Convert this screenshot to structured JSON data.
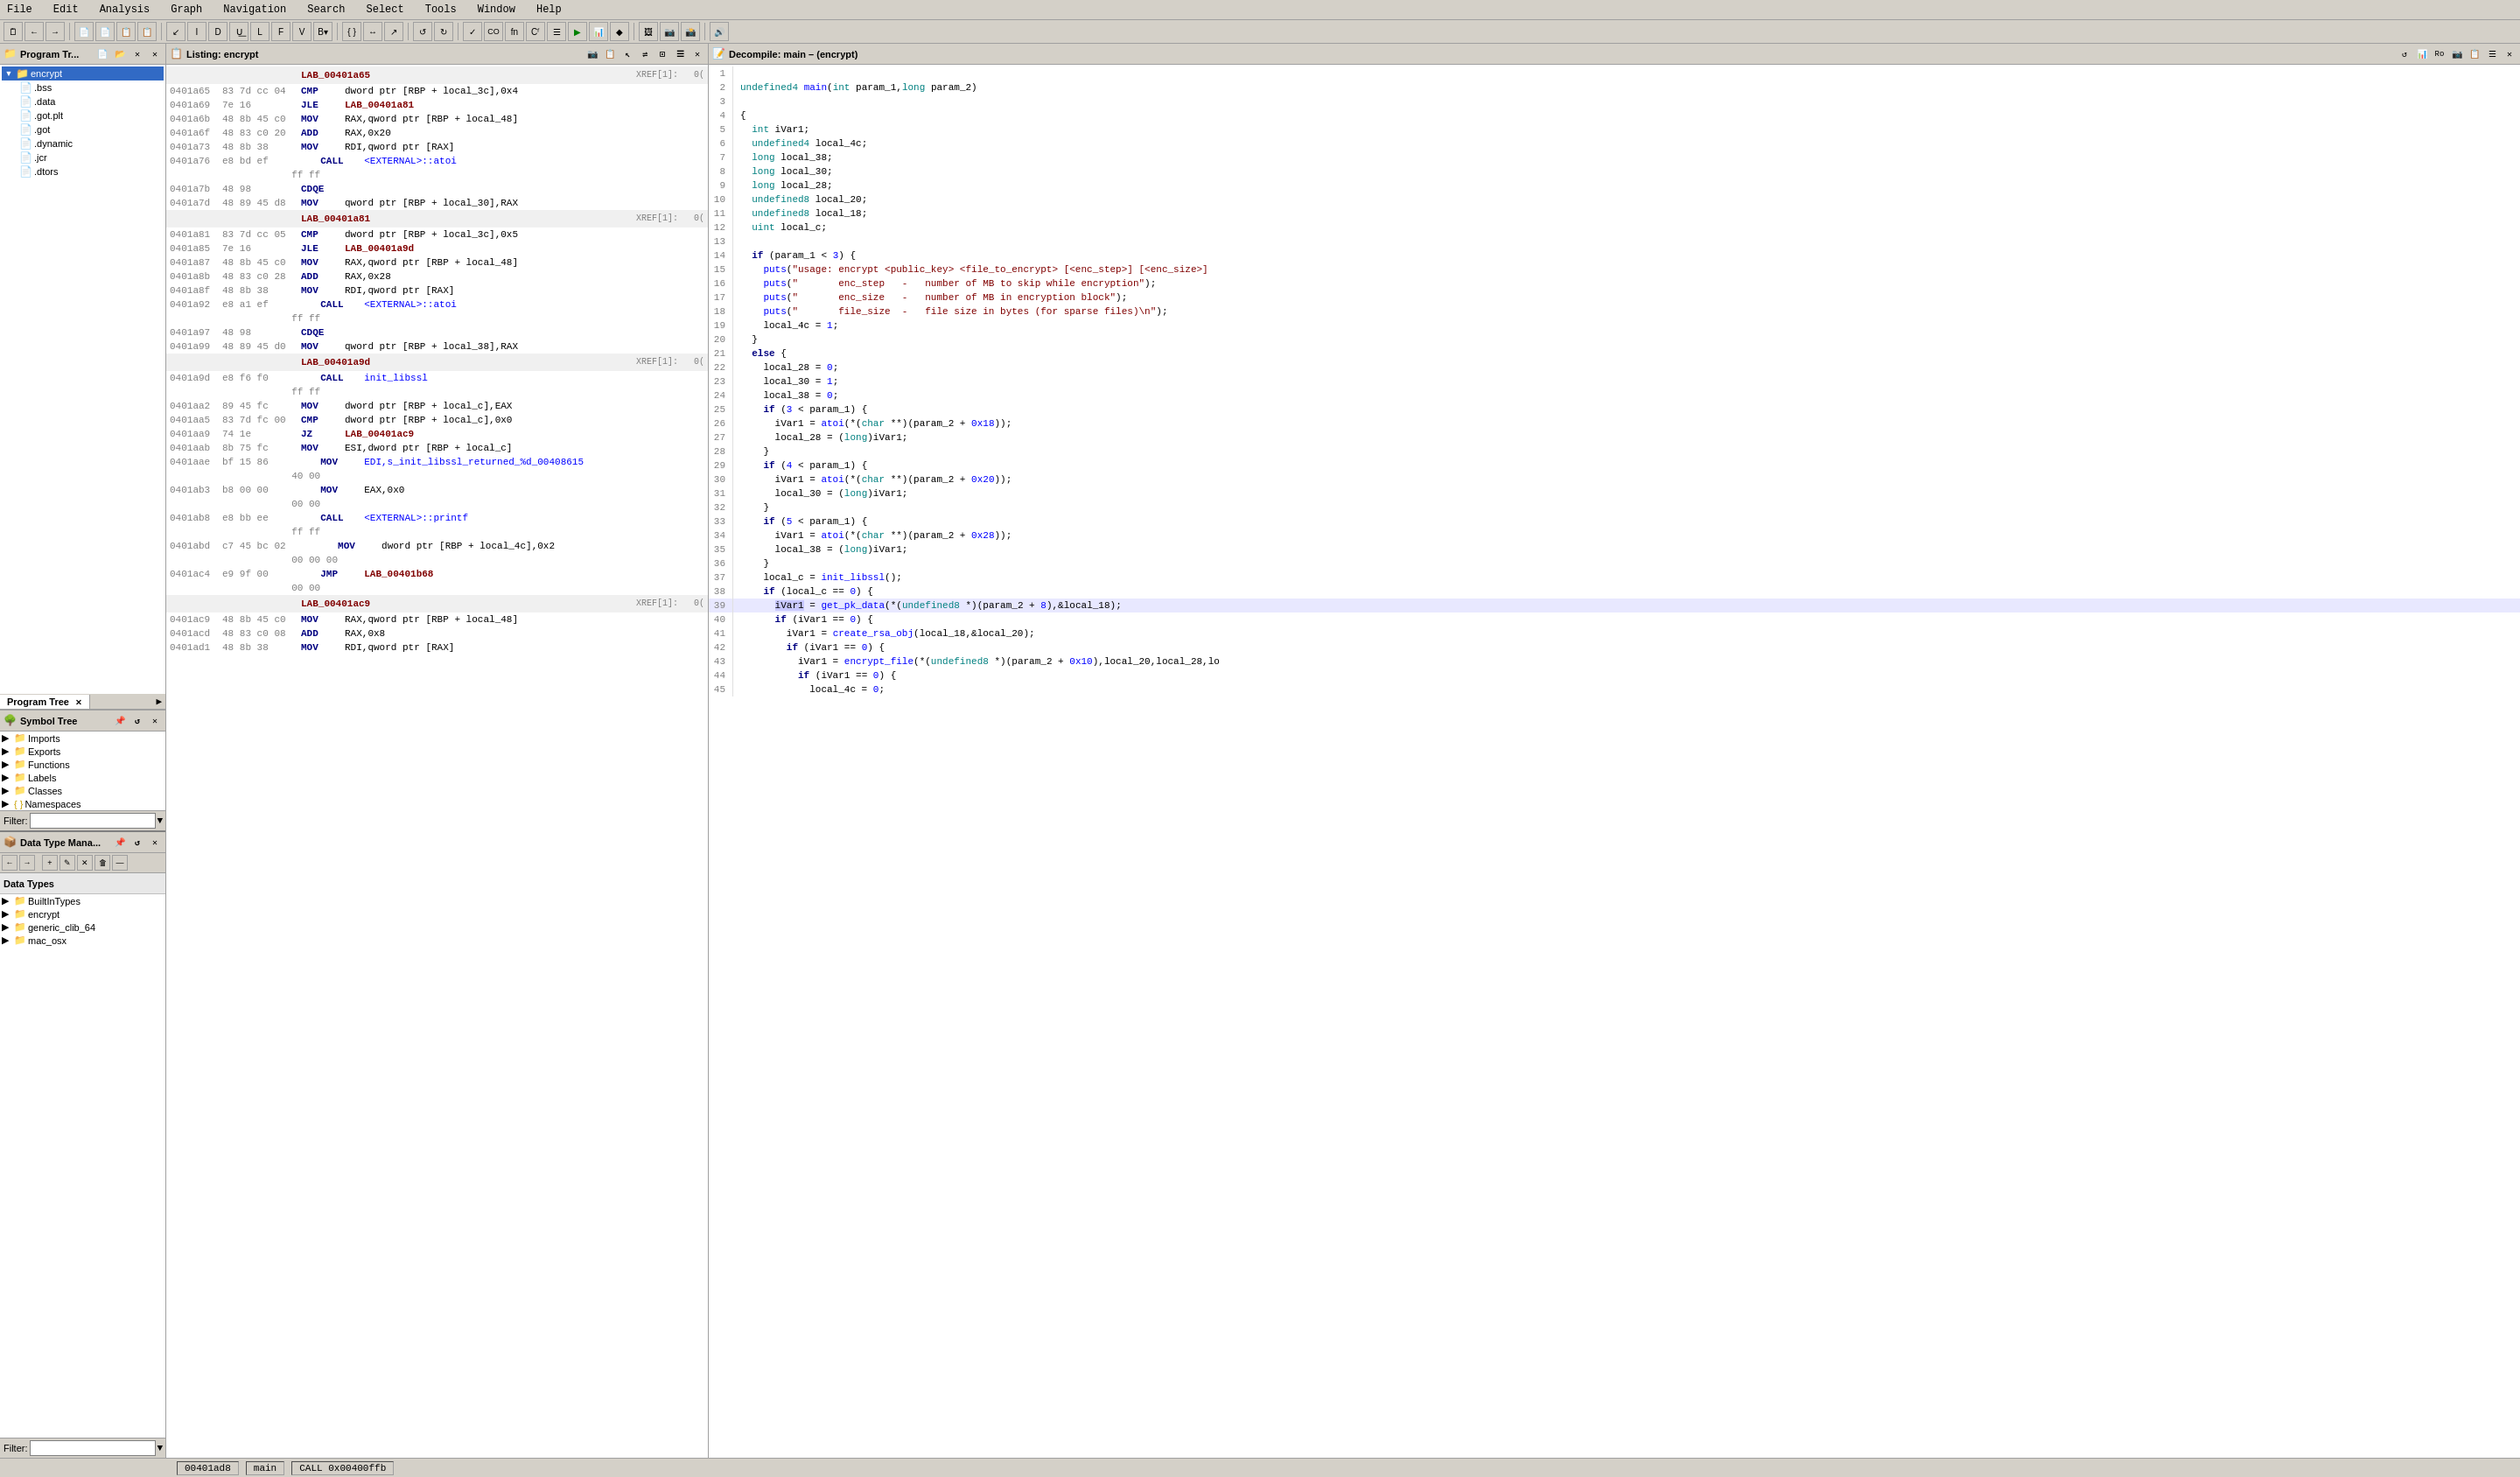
{
  "menu": {
    "items": [
      "File",
      "Edit",
      "Analysis",
      "Graph",
      "Navigation",
      "Search",
      "Select",
      "Tools",
      "Window",
      "Help"
    ]
  },
  "program_tree": {
    "title": "Program Tr...",
    "root": {
      "name": "encrypt",
      "expanded": true,
      "children": [
        {
          "name": ".bss",
          "type": "file"
        },
        {
          "name": ".data",
          "type": "file"
        },
        {
          "name": ".got.plt",
          "type": "file"
        },
        {
          "name": ".got",
          "type": "file"
        },
        {
          "name": ".dynamic",
          "type": "file"
        },
        {
          "name": ".jcr",
          "type": "file"
        },
        {
          "name": ".dtors",
          "type": "file"
        }
      ]
    },
    "tab_label": "Program Tree",
    "filter_label": "Filter:"
  },
  "symbol_tree": {
    "title": "Symbol Tree",
    "items": [
      {
        "name": "Imports",
        "type": "folder",
        "expanded": false
      },
      {
        "name": "Exports",
        "type": "folder",
        "expanded": false
      },
      {
        "name": "Functions",
        "type": "folder",
        "expanded": false
      },
      {
        "name": "Labels",
        "type": "folder",
        "expanded": false
      },
      {
        "name": "Classes",
        "type": "folder",
        "expanded": false
      },
      {
        "name": "Namespaces",
        "type": "folder",
        "expanded": false
      }
    ],
    "filter_label": "Filter:"
  },
  "data_type_mgr": {
    "title": "Data Type Mana...",
    "items": [
      {
        "name": "BuiltInTypes",
        "type": "folder",
        "expanded": false
      },
      {
        "name": "encrypt",
        "type": "folder",
        "expanded": false
      },
      {
        "name": "generic_clib_64",
        "type": "folder",
        "expanded": false
      },
      {
        "name": "mac_osx",
        "type": "folder",
        "expanded": false
      }
    ],
    "label": "Data Types"
  },
  "listing": {
    "title": "Listing: encrypt",
    "lines": [
      {
        "type": "label",
        "label": "LAB_00401a65",
        "xref": "XREF[1]:",
        "xref_addr": "0("
      },
      {
        "type": "asm",
        "addr": "0401a65",
        "bytes": "83 7d cc 04",
        "mnem": "CMP",
        "op": "dword ptr [RBP + local_3c],0x4"
      },
      {
        "type": "asm",
        "addr": "0401a69",
        "bytes": "7e 16",
        "mnem": "JLE",
        "op": "LAB_00401a81"
      },
      {
        "type": "asm",
        "addr": "0401a6b",
        "bytes": "48 8b 45 c0",
        "mnem": "MOV",
        "op": "RAX,qword ptr [RBP + local_48]"
      },
      {
        "type": "asm",
        "addr": "0401a6f",
        "bytes": "48 83 c0 20",
        "mnem": "ADD",
        "op": "RAX,0x20"
      },
      {
        "type": "asm",
        "addr": "0401a73",
        "bytes": "48 8b 38",
        "mnem": "MOV",
        "op": "RDI,qword ptr [RAX]"
      },
      {
        "type": "asm",
        "addr": "0401a76",
        "bytes": "e8 bd ef ff ff",
        "mnem": "CALL",
        "op": "<EXTERNAL>::atoi",
        "func": true
      },
      {
        "type": "asm",
        "addr": "0401a7b",
        "bytes": "48 98",
        "mnem": "CDQE",
        "op": ""
      },
      {
        "type": "asm",
        "addr": "0401a7d",
        "bytes": "48 89 45 d8",
        "mnem": "MOV",
        "op": "qword ptr [RBP + local_30],RAX"
      },
      {
        "type": "label",
        "label": "LAB_00401a81",
        "xref": "XREF[1]:",
        "xref_addr": "0("
      },
      {
        "type": "asm",
        "addr": "0401a81",
        "bytes": "83 7d cc 05",
        "mnem": "CMP",
        "op": "dword ptr [RBP + local_3c],0x5"
      },
      {
        "type": "asm",
        "addr": "0401a85",
        "bytes": "7e 16",
        "mnem": "JLE",
        "op": "LAB_00401a9d"
      },
      {
        "type": "asm",
        "addr": "0401a87",
        "bytes": "48 8b 45 c0",
        "mnem": "MOV",
        "op": "RAX,qword ptr [RBP + local_48]"
      },
      {
        "type": "asm",
        "addr": "0401a8b",
        "bytes": "48 83 c0 28",
        "mnem": "ADD",
        "op": "RAX,0x28"
      },
      {
        "type": "asm",
        "addr": "0401a8f",
        "bytes": "48 8b 38",
        "mnem": "MOV",
        "op": "RDI,qword ptr [RAX]"
      },
      {
        "type": "asm",
        "addr": "0401a92",
        "bytes": "e8 a1 ef ff ff",
        "mnem": "CALL",
        "op": "<EXTERNAL>::atoi",
        "func": true
      },
      {
        "type": "asm",
        "addr": "0401a97",
        "bytes": "48 98",
        "mnem": "CDQE",
        "op": ""
      },
      {
        "type": "asm",
        "addr": "0401a99",
        "bytes": "48 89 45 d0",
        "mnem": "MOV",
        "op": "qword ptr [RBP + local_38],RAX"
      },
      {
        "type": "label",
        "label": "LAB_00401a9d",
        "xref": "XREF[1]:",
        "xref_addr": "0("
      },
      {
        "type": "asm",
        "addr": "0401a9d",
        "bytes": "e8 f6 f0 ff ff",
        "mnem": "CALL",
        "op": "init_libssl",
        "func": true
      },
      {
        "type": "asm",
        "addr": "0401aa2",
        "bytes": "89 45 fc",
        "mnem": "MOV",
        "op": "dword ptr [RBP + local_c],EAX"
      },
      {
        "type": "asm",
        "addr": "0401aa5",
        "bytes": "83 7d fc 00",
        "mnem": "CMP",
        "op": "dword ptr [RBP + local_c],0x0"
      },
      {
        "type": "asm",
        "addr": "0401aa9",
        "bytes": "74 1e",
        "mnem": "JZ",
        "op": "LAB_00401ac9"
      },
      {
        "type": "asm",
        "addr": "0401aab",
        "bytes": "8b 75 fc",
        "mnem": "MOV",
        "op": "ESI,dword ptr [RBP + local_c]"
      },
      {
        "type": "asm",
        "addr": "0401aae",
        "bytes": "bf 15 86 40 00",
        "mnem": "MOV",
        "op": "EDI,s_init_libssl_returned_%d_00408615",
        "func": true
      },
      {
        "type": "asm",
        "addr": "0401ab3",
        "bytes": "b8 00 00 00 00",
        "mnem": "MOV",
        "op": "EAX,0x0"
      },
      {
        "type": "asm",
        "addr": "0401ab8",
        "bytes": "e8 bb ee ff ff",
        "mnem": "CALL",
        "op": "<EXTERNAL>::printf",
        "func": true
      },
      {
        "type": "asm",
        "addr": "0401abd",
        "bytes": "c7 45 bc 02 00 00 00",
        "mnem": "MOV",
        "op": "dword ptr [RBP + local_4c],0x2"
      },
      {
        "type": "asm",
        "addr": "0401ac4",
        "bytes": "e9 9f 00 00 00",
        "mnem": "JMP",
        "op": "LAB_00401b68"
      },
      {
        "type": "label",
        "label": "LAB_00401ac9",
        "xref": "XREF[1]:",
        "xref_addr": "0("
      },
      {
        "type": "asm",
        "addr": "0401ac9",
        "bytes": "48 8b 45 c0",
        "mnem": "MOV",
        "op": "RAX,qword ptr [RBP + local_48]"
      },
      {
        "type": "asm",
        "addr": "0401acd",
        "bytes": "48 83 c0 08",
        "mnem": "ADD",
        "op": "RAX,0x8"
      },
      {
        "type": "asm",
        "addr": "0401ad1",
        "bytes": "48 8b 38",
        "mnem": "MOV",
        "op": "RDI,qword ptr [RAX]"
      }
    ]
  },
  "decompiler": {
    "title": "Decompile: main – (encrypt)",
    "lines": [
      {
        "num": 1,
        "text": ""
      },
      {
        "num": 2,
        "text": "undefined4 main(int param_1,long param_2)"
      },
      {
        "num": 3,
        "text": ""
      },
      {
        "num": 4,
        "text": "{"
      },
      {
        "num": 5,
        "text": "  int iVar1;"
      },
      {
        "num": 6,
        "text": "  undefined4 local_4c;"
      },
      {
        "num": 7,
        "text": "  long local_38;"
      },
      {
        "num": 8,
        "text": "  long local_30;"
      },
      {
        "num": 9,
        "text": "  long local_28;"
      },
      {
        "num": 10,
        "text": "  undefined8 local_20;"
      },
      {
        "num": 11,
        "text": "  undefined8 local_18;"
      },
      {
        "num": 12,
        "text": "  uint local_c;"
      },
      {
        "num": 13,
        "text": ""
      },
      {
        "num": 14,
        "text": "  if (param_1 < 3) {"
      },
      {
        "num": 15,
        "text": "    puts(\"usage: encrypt <public_key> <file_to_encrypt> [<enc_step>] [<enc_size>]"
      },
      {
        "num": 16,
        "text": "    puts(\"       enc_step   -   number of MB to skip while encryption\");"
      },
      {
        "num": 17,
        "text": "    puts(\"       enc_size   -   number of MB in encryption block\");"
      },
      {
        "num": 18,
        "text": "    puts(\"       file_size  -   file size in bytes (for sparse files)\\n\");"
      },
      {
        "num": 19,
        "text": "    local_4c = 1;"
      },
      {
        "num": 20,
        "text": "  }"
      },
      {
        "num": 21,
        "text": "  else {"
      },
      {
        "num": 22,
        "text": "    local_28 = 0;"
      },
      {
        "num": 23,
        "text": "    local_30 = 1;"
      },
      {
        "num": 24,
        "text": "    local_38 = 0;"
      },
      {
        "num": 25,
        "text": "    if (3 < param_1) {"
      },
      {
        "num": 26,
        "text": "      iVar1 = atoi(*(char **)(param_2 + 0x18));"
      },
      {
        "num": 27,
        "text": "      local_28 = (long)iVar1;"
      },
      {
        "num": 28,
        "text": "    }"
      },
      {
        "num": 29,
        "text": "    if (4 < param_1) {"
      },
      {
        "num": 30,
        "text": "      iVar1 = atoi(*(char **)(param_2 + 0x20));"
      },
      {
        "num": 31,
        "text": "      local_30 = (long)iVar1;"
      },
      {
        "num": 32,
        "text": "    }"
      },
      {
        "num": 33,
        "text": "    if (5 < param_1) {"
      },
      {
        "num": 34,
        "text": "      iVar1 = atoi(*(char **)(param_2 + 0x28));"
      },
      {
        "num": 35,
        "text": "      local_38 = (long)iVar1;"
      },
      {
        "num": 36,
        "text": "    }"
      },
      {
        "num": 37,
        "text": "    local_c = init_libssl();"
      },
      {
        "num": 38,
        "text": "    if (local_c == 0) {"
      },
      {
        "num": 39,
        "text": "      iVar1 = get_pk_data(*(undefined8 *)(param_2 + 8),&local_18);",
        "highlight": true
      },
      {
        "num": 40,
        "text": "      if (iVar1 == 0) {"
      },
      {
        "num": 41,
        "text": "        iVar1 = create_rsa_obj(local_18,&local_20);"
      },
      {
        "num": 42,
        "text": "        if (iVar1 == 0) {"
      },
      {
        "num": 43,
        "text": "          iVar1 = encrypt_file(*(undefined8 *)(param_2 + 0x10),local_20,local_28,lo"
      },
      {
        "num": 44,
        "text": "          if (iVar1 == 0) {"
      },
      {
        "num": 45,
        "text": "            local_4c = 0;"
      }
    ]
  },
  "status_bar": {
    "addr": "00401ad8",
    "func": "main",
    "call_info": "CALL 0x00400ffb"
  },
  "icons": {
    "folder": "📁",
    "file": "📄",
    "expand": "▶",
    "collapse": "▼",
    "close": "✕",
    "arrow_right": "▶",
    "arrow_left": "◀",
    "refresh": "↺",
    "search": "🔍",
    "pin": "📌",
    "lock": "🔒",
    "home": "🏠",
    "back": "←",
    "forward": "→",
    "run": "▶",
    "stop": "■",
    "settings": "⚙",
    "up": "▲",
    "down": "▼",
    "new": "+",
    "delete": "✕",
    "filter": "🔽"
  }
}
